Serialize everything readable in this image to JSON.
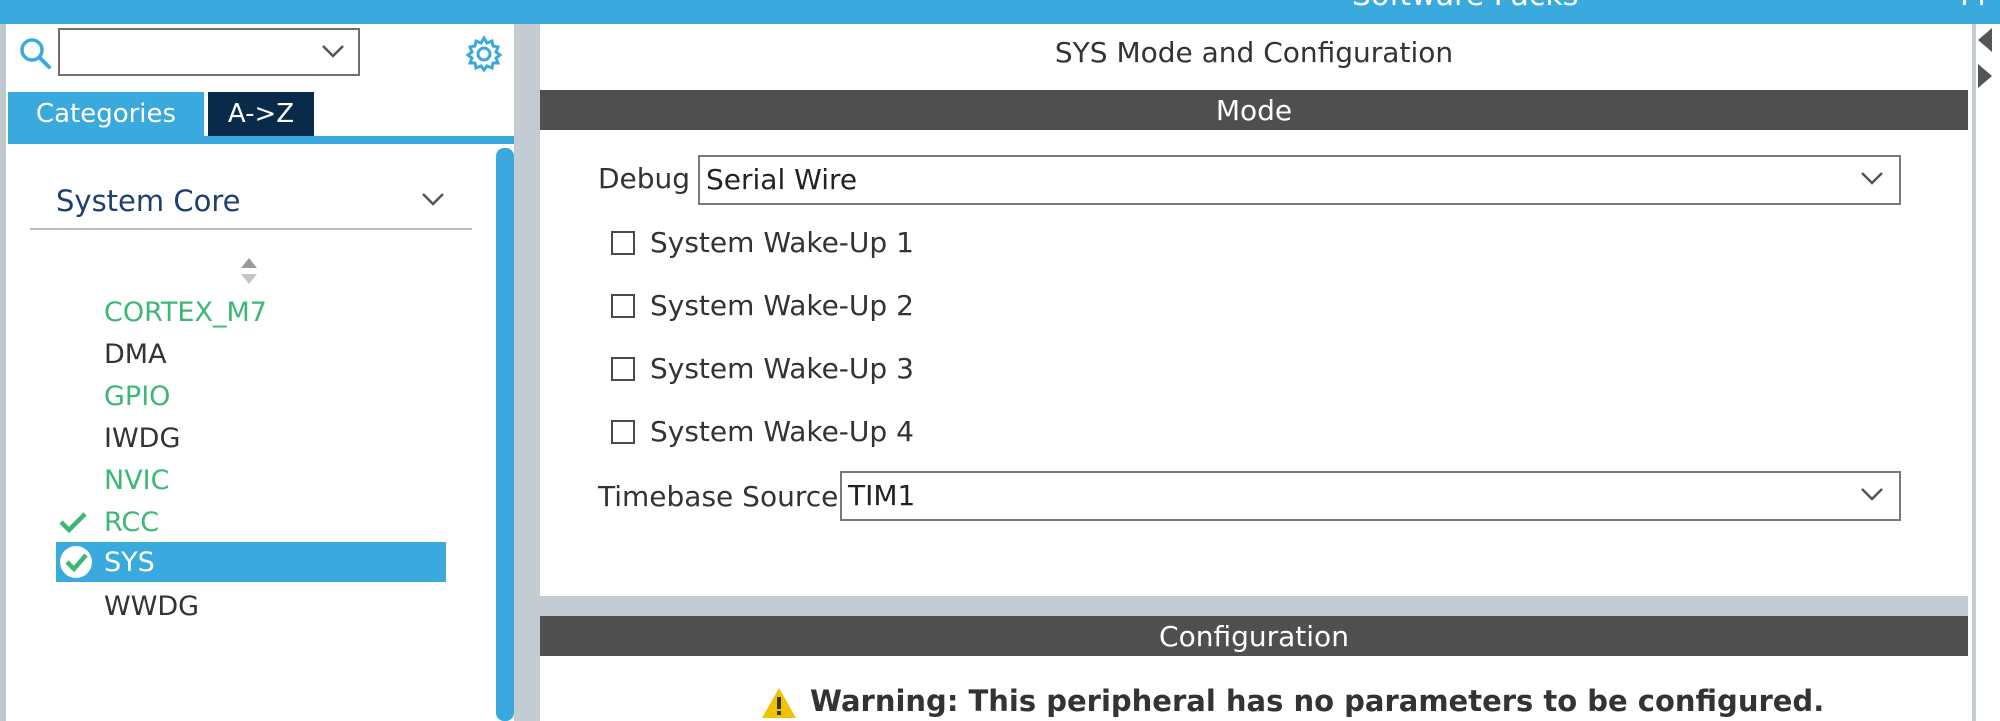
{
  "topbar": {
    "text_1": "Software Packs",
    "text_2": "Pi"
  },
  "left_panel": {
    "search": {
      "value": ""
    },
    "tabs": [
      {
        "label": "Categories",
        "active": true
      },
      {
        "label": "A->Z",
        "active": false
      }
    ],
    "category": "System Core",
    "items": [
      {
        "label": "CORTEX_M7",
        "color": "#3cb774",
        "state": "configured"
      },
      {
        "label": "DMA",
        "color": "#333333",
        "state": "default"
      },
      {
        "label": "GPIO",
        "color": "#3cb774",
        "state": "configured"
      },
      {
        "label": "IWDG",
        "color": "#333333",
        "state": "default"
      },
      {
        "label": "NVIC",
        "color": "#3cb774",
        "state": "configured"
      },
      {
        "label": "RCC",
        "color": "#3cb774",
        "state": "check"
      },
      {
        "label": "SYS",
        "color": "#ffffff",
        "state": "selected-check"
      },
      {
        "label": "WWDG",
        "color": "#333333",
        "state": "default"
      }
    ]
  },
  "main": {
    "title": "SYS Mode and Configuration",
    "mode_header": "Mode",
    "debug_label": "Debug",
    "debug_value": "Serial Wire",
    "checkboxes": [
      {
        "label": "System Wake-Up 1",
        "checked": false
      },
      {
        "label": "System Wake-Up 2",
        "checked": false
      },
      {
        "label": "System Wake-Up 3",
        "checked": false
      },
      {
        "label": "System Wake-Up 4",
        "checked": false
      }
    ],
    "timebase_label": "Timebase Source",
    "timebase_value": "TIM1",
    "config_header": "Configuration",
    "warning": "Warning: This peripheral has no parameters to be configured."
  },
  "colors": {
    "accent": "#3aa9dd",
    "header_bg": "#4f4f4f",
    "ok_green": "#3cb774",
    "warning_yellow": "#f2c200"
  }
}
